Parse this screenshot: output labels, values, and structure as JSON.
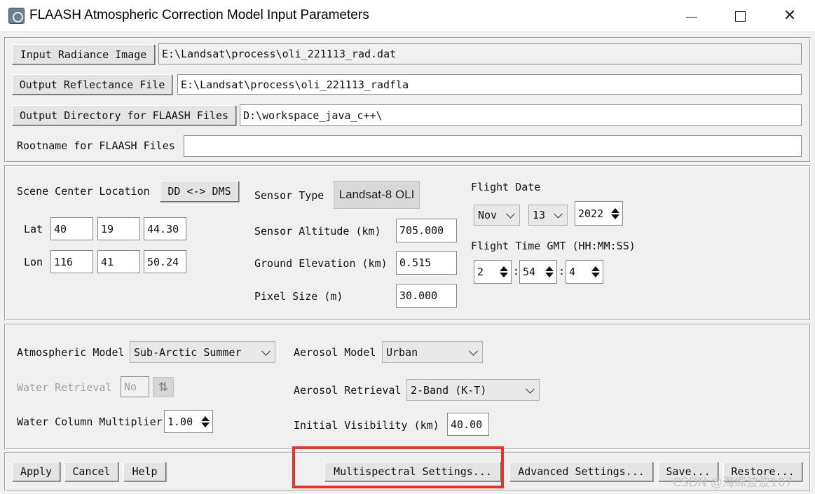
{
  "window": {
    "title": "FLAASH Atmospheric Correction Model Input Parameters",
    "min_glyph": "minimize",
    "max_glyph": "maximize",
    "close_glyph": "✕"
  },
  "files": {
    "input_button": "Input Radiance Image",
    "input_value": "E:\\Landsat\\process\\oli_221113_rad.dat",
    "output_button": "Output Reflectance File",
    "output_value": "E:\\Landsat\\process\\oli_221113_radfla",
    "dir_button": "Output Directory for FLAASH Files",
    "dir_value": "D:\\workspace_java_c++\\",
    "rootname_label": "Rootname for FLAASH Files",
    "rootname_value": ""
  },
  "scene": {
    "label": "Scene Center Location",
    "dd_dms_button": "DD <-> DMS",
    "lat_label": "Lat",
    "lat": [
      "40",
      "19",
      "44.30"
    ],
    "lon_label": "Lon",
    "lon": [
      "116",
      "41",
      "50.24"
    ]
  },
  "sensor": {
    "type_label": "Sensor Type",
    "type_value": "Landsat-8 OLI",
    "altitude_label": "Sensor Altitude (km)",
    "altitude_value": "705.000",
    "ground_label": "Ground Elevation (km)",
    "ground_value": "0.515",
    "pixel_label": "Pixel Size (m)",
    "pixel_value": "30.000"
  },
  "flight": {
    "date_label": "Flight Date",
    "month": "Nov",
    "day": "13",
    "year": "2022",
    "time_label": "Flight Time GMT (HH:MM:SS)",
    "hh": "2",
    "mm": "54",
    "ss": "4",
    "separator": ":"
  },
  "atmosphere": {
    "model_label": "Atmospheric Model",
    "model_value": "Sub-Arctic Summer",
    "water_retrieval_label": "Water Retrieval",
    "water_retrieval_value": "No",
    "water_column_label": "Water Column Multiplier",
    "water_column_value": "1.00",
    "aerosol_model_label": "Aerosol Model",
    "aerosol_model_value": "Urban",
    "aerosol_retrieval_label": "Aerosol Retrieval",
    "aerosol_retrieval_value": "2-Band (K-T)",
    "visibility_label": "Initial Visibility (km)",
    "visibility_value": "40.00"
  },
  "footer": {
    "apply": "Apply",
    "cancel": "Cancel",
    "help": "Help",
    "multispectral": "Multispectral Settings...",
    "advanced": "Advanced Settings...",
    "save": "Save...",
    "restore": "Restore..."
  },
  "watermark": "CSDN @海绵波波107",
  "colors": {
    "highlight": "#e4332f",
    "background": "#f0f0f0"
  }
}
